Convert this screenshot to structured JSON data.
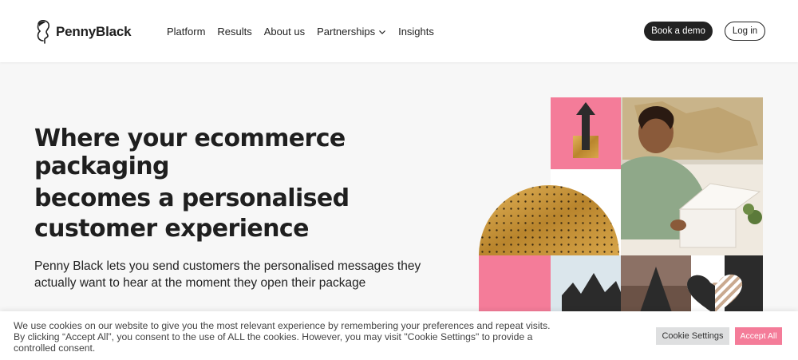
{
  "brand": {
    "name": "PennyBlack"
  },
  "nav": {
    "items": [
      {
        "label": "Platform"
      },
      {
        "label": "Results"
      },
      {
        "label": "About us"
      },
      {
        "label": "Partnerships",
        "has_dropdown": true
      },
      {
        "label": "Insights"
      }
    ]
  },
  "header_actions": {
    "demo_label": "Book a demo",
    "login_label": "Log in"
  },
  "hero": {
    "headline_line1": "Where your ecommerce packaging",
    "headline_line2": "becomes a personalised",
    "headline_line3": "customer experience",
    "subtext": "Penny Black lets you send customers the personalised messages they actually want to hear at the moment they open their package"
  },
  "cookie": {
    "text": "We use cookies on our website to give you the most relevant experience by remembering your preferences and repeat visits. By clicking “Accept All”, you consent to the use of ALL the cookies. However, you may visit \"Cookie Settings\" to provide a controlled consent.",
    "settings_label": "Cookie Settings",
    "accept_label": "Accept All"
  },
  "colors": {
    "accent_pink": "#f47c99",
    "dark": "#222222",
    "gold": "#c99a3c",
    "light_blue": "#dbe6ec"
  }
}
